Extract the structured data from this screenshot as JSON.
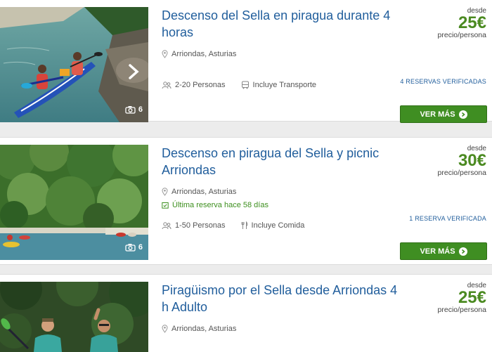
{
  "colors": {
    "title_blue": "#215e9c",
    "price_green": "#4b8a21",
    "button_green": "#3f8e22",
    "booking_green": "#3d8f1e"
  },
  "cards": [
    {
      "title": "Descenso del Sella en piragua durante 4 horas",
      "location": "Arriondas, Asturias",
      "people": "2-20 Personas",
      "extra": "Incluye Transporte",
      "extra_icon": "bus-icon",
      "photo_count": "6",
      "price_from": "desde",
      "price": "25€",
      "price_per": "precio/persona",
      "verified": "4 RESERVAS VERIFICADAS",
      "button": "VER MÁS"
    },
    {
      "title": "Descenso en piragua del Sella y picnic Arriondas",
      "location": "Arriondas, Asturias",
      "last_booking": "Última reserva hace 58 días",
      "people": "1-50 Personas",
      "extra": "Incluye Comida",
      "extra_icon": "cutlery-icon",
      "photo_count": "6",
      "price_from": "desde",
      "price": "30€",
      "price_per": "precio/persona",
      "verified": "1 RESERVA VERIFICADA",
      "button": "VER MÁS"
    },
    {
      "title": "Piragüismo por el Sella desde Arriondas 4 h Adulto",
      "location": "Arriondas, Asturias",
      "price_from": "desde",
      "price": "25€",
      "price_per": "precio/persona"
    }
  ]
}
